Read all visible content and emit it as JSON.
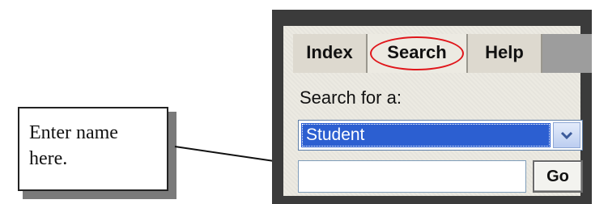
{
  "callout": {
    "line1": "Enter name",
    "line2": "here."
  },
  "tabs": [
    {
      "label": "Index"
    },
    {
      "label": "Search",
      "active": true,
      "highlighted": true
    },
    {
      "label": "Help"
    }
  ],
  "search": {
    "label": "Search for a:",
    "selected_option": "Student",
    "input_value": "",
    "go_label": "Go"
  },
  "colors": {
    "panel_border": "#3b3b3b",
    "highlight_oval": "#e0161b",
    "selection": "#2c5fd1"
  }
}
